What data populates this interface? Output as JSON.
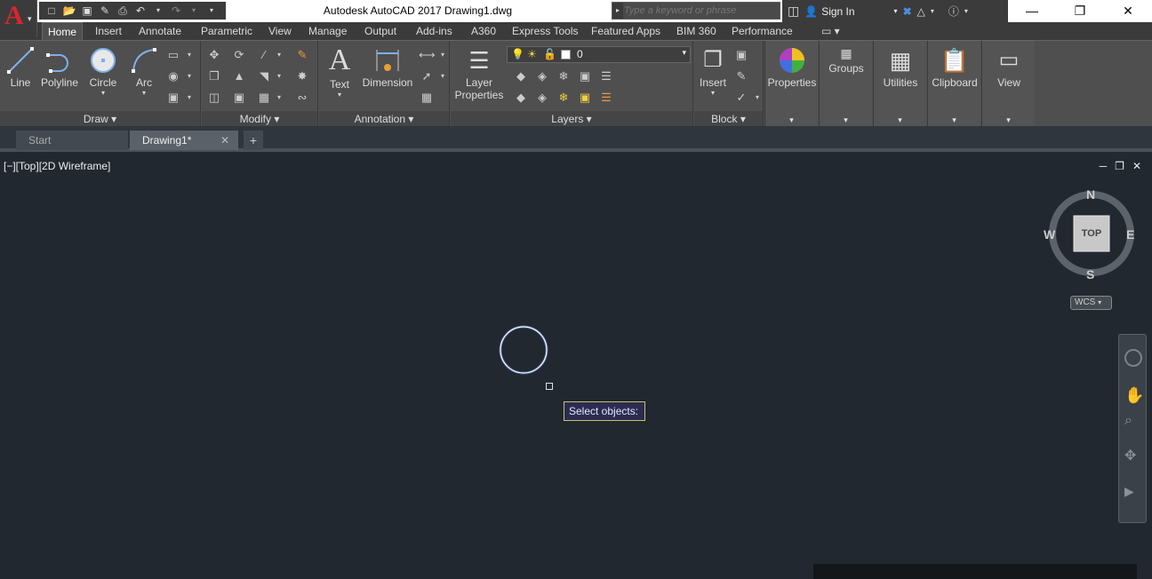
{
  "app": {
    "title": "Autodesk AutoCAD 2017    Drawing1.dwg",
    "logo_letter": "A",
    "search_placeholder": "Type a keyword or phrase",
    "sign_in": "Sign In"
  },
  "ribbon_tabs": [
    "Home",
    "Insert",
    "Annotate",
    "Parametric",
    "View",
    "Manage",
    "Output",
    "Add-ins",
    "A360",
    "Express Tools",
    "Featured Apps",
    "BIM 360",
    "Performance"
  ],
  "draw_panel": {
    "title": "Draw",
    "line": "Line",
    "polyline": "Polyline",
    "circle": "Circle",
    "arc": "Arc"
  },
  "modify_panel": {
    "title": "Modify"
  },
  "annotation_panel": {
    "title": "Annotation",
    "text": "Text",
    "dimension": "Dimension"
  },
  "layers_panel": {
    "title": "Layers",
    "layer_properties_1": "Layer",
    "layer_properties_2": "Properties",
    "current_layer": "0"
  },
  "block_panel": {
    "title": "Block",
    "insert": "Insert"
  },
  "extra_panels": {
    "properties": "Properties",
    "groups": "Groups",
    "utilities": "Utilities",
    "clipboard": "Clipboard",
    "view": "View"
  },
  "file_tabs": {
    "start": "Start",
    "drawing": "Drawing1*"
  },
  "viewport": {
    "label": "[−][Top][2D Wireframe]",
    "prompt": "Select objects:"
  },
  "viewcube": {
    "north": "N",
    "south": "S",
    "east": "E",
    "west": "W",
    "face": "TOP",
    "ucs": "WCS"
  },
  "colors": {
    "canvas": "#212830",
    "ribbon": "#4f4f4f",
    "accent_red": "#d8262b",
    "circle": "#6f97e8"
  }
}
